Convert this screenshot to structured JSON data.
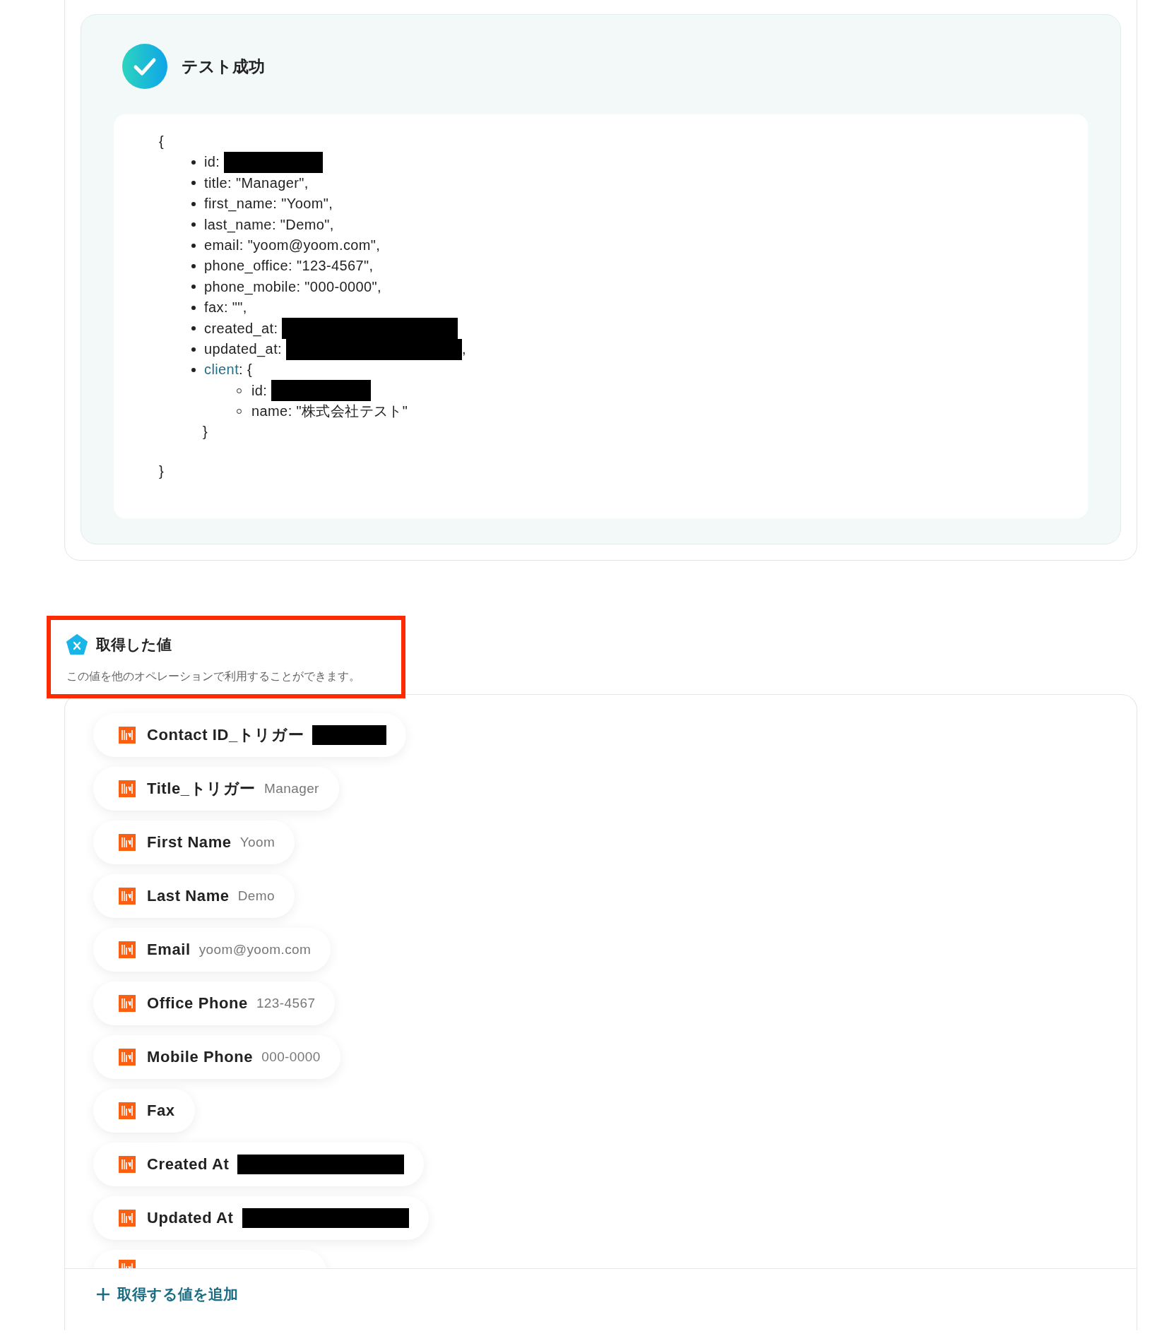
{
  "test_result": {
    "success": true,
    "title": "テスト成功",
    "code_lines": [
      {
        "kind": "brace",
        "text": "{"
      },
      {
        "kind": "item",
        "text": "id:",
        "redacted": true
      },
      {
        "kind": "item",
        "text": "title: \"Manager\","
      },
      {
        "kind": "item",
        "text": "first_name: \"Yoom\","
      },
      {
        "kind": "item",
        "text": "last_name: \"Demo\","
      },
      {
        "kind": "item",
        "text": "email: \"yoom@yoom.com\","
      },
      {
        "kind": "item",
        "text": "phone_office: \"123-4567\","
      },
      {
        "kind": "item",
        "text": "phone_mobile: \"000-0000\","
      },
      {
        "kind": "item",
        "text": "fax: \"\","
      },
      {
        "kind": "item",
        "text": "created_at:",
        "redacted": true
      },
      {
        "kind": "item",
        "text": "updated_at:",
        "redacted": true,
        "after": ","
      },
      {
        "kind": "item",
        "key": "client",
        "text": ": {"
      },
      {
        "kind": "subitem",
        "text": "id:",
        "redacted": true
      },
      {
        "kind": "subitem",
        "text": "name: \"株式会社テスト\""
      },
      {
        "kind": "inner_close",
        "text": "}"
      },
      {
        "kind": "close",
        "text": "}"
      }
    ]
  },
  "acquired_values": {
    "highlighted": true,
    "title": "取得した値",
    "description": "この値を他のオペレーションで利用することができます。",
    "values": [
      {
        "label": "Contact ID_トリガー",
        "redacted": true
      },
      {
        "label": "Title_トリガー",
        "value": "Manager"
      },
      {
        "label": "First Name",
        "value": "Yoom"
      },
      {
        "label": "Last Name",
        "value": "Demo"
      },
      {
        "label": "Email",
        "value": "yoom@yoom.com"
      },
      {
        "label": "Office Phone",
        "value": "123-4567"
      },
      {
        "label": "Mobile Phone",
        "value": "000-0000"
      },
      {
        "label": "Fax"
      },
      {
        "label": "Created At",
        "redacted": true
      },
      {
        "label": "Updated At",
        "redacted": true
      },
      {
        "cut_off": true
      }
    ],
    "add_button": "取得する値を追加"
  }
}
